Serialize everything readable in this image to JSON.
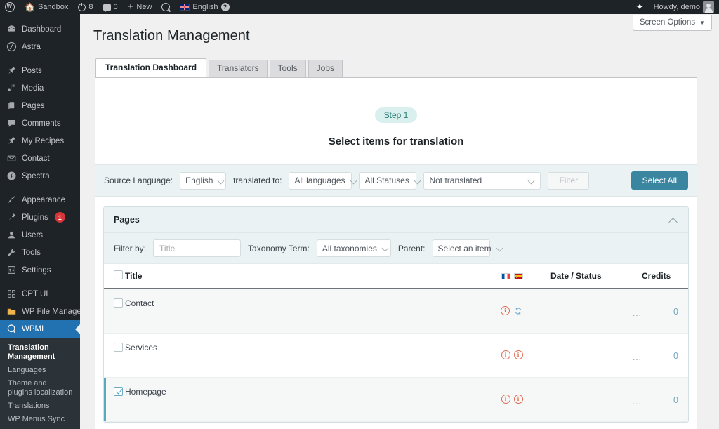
{
  "adminbar": {
    "logo_icon": "wordpress-logo-icon",
    "items": [
      {
        "icon": "home-icon",
        "label": "Sandbox"
      },
      {
        "icon": "updates-icon",
        "label": "8"
      },
      {
        "icon": "comment-bubble-icon",
        "label": "0"
      },
      {
        "icon": "plus-icon",
        "label": "New"
      },
      {
        "icon": "query-monitor-icon",
        "label": ""
      },
      {
        "icon": "uk-flag-icon",
        "label": "English",
        "badge": "?"
      }
    ],
    "right": {
      "sparkle_icon": "sparkle-icon",
      "greeting": "Howdy, demo",
      "avatar_icon": "avatar"
    }
  },
  "sidebar": {
    "items": [
      {
        "label": "Dashboard",
        "icon": "dashboard-icon"
      },
      {
        "label": "Astra",
        "icon": "astra-icon"
      },
      {
        "separator": true
      },
      {
        "label": "Posts",
        "icon": "pin-icon"
      },
      {
        "label": "Media",
        "icon": "media-icon"
      },
      {
        "label": "Pages",
        "icon": "pages-icon"
      },
      {
        "label": "Comments",
        "icon": "comment-icon"
      },
      {
        "label": "My Recipes",
        "icon": "pin-icon"
      },
      {
        "label": "Contact",
        "icon": "envelope-icon"
      },
      {
        "label": "Spectra",
        "icon": "spectra-icon"
      },
      {
        "separator": true
      },
      {
        "label": "Appearance",
        "icon": "brush-icon"
      },
      {
        "label": "Plugins",
        "icon": "plug-icon",
        "badge": "1"
      },
      {
        "label": "Users",
        "icon": "user-icon"
      },
      {
        "label": "Tools",
        "icon": "wrench-icon"
      },
      {
        "label": "Settings",
        "icon": "settings-icon"
      },
      {
        "separator": true
      },
      {
        "label": "CPT UI",
        "icon": "cptui-icon"
      },
      {
        "label": "WP File Manager",
        "icon": "folder-icon"
      },
      {
        "label": "WPML",
        "icon": "wpml-icon",
        "current": true
      }
    ],
    "submenu": [
      {
        "label": "Translation Management",
        "active": true
      },
      {
        "label": "Languages"
      },
      {
        "label": "Theme and plugins localization"
      },
      {
        "label": "Translations"
      },
      {
        "label": "WP Menus Sync"
      }
    ]
  },
  "screen_options": {
    "label": "Screen Options",
    "caret": "▼"
  },
  "page": {
    "title": "Translation Management"
  },
  "tabs": [
    {
      "label": "Translation Dashboard",
      "active": true
    },
    {
      "label": "Translators",
      "active": false
    },
    {
      "label": "Tools",
      "active": false
    },
    {
      "label": "Jobs",
      "active": false
    }
  ],
  "step": {
    "pill": "Step 1",
    "heading": "Select items for translation"
  },
  "filterbar": {
    "source_language_label": "Source Language:",
    "source_language_value": "English",
    "translated_to_label": "translated to:",
    "all_languages_value": "All languages",
    "all_statuses_value": "All Statuses",
    "not_translated_value": "Not translated",
    "filter_button": "Filter",
    "select_all_button": "Select All",
    "accent_color": "#3a86a0"
  },
  "pages_box": {
    "title": "Pages",
    "collapse_icon": "chevron-up-icon",
    "filter_by_label": "Filter by:",
    "filter_by_placeholder": "Title",
    "taxonomy_label": "Taxonomy Term:",
    "taxonomy_value": "All taxonomies",
    "parent_label": "Parent:",
    "parent_value": "Select an item"
  },
  "table": {
    "columns": {
      "title": "Title",
      "languages": [
        "fr",
        "es"
      ],
      "date_status": "Date / Status",
      "credits": "Credits"
    },
    "header_checkbox_checked": false,
    "rows": [
      {
        "title": "Contact",
        "checked": false,
        "lang_icons": [
          "not-translated-icon",
          "needs-update-icon"
        ],
        "date_status": "...",
        "credits": "0"
      },
      {
        "title": "Services",
        "checked": false,
        "lang_icons": [
          "not-translated-icon",
          "not-translated-icon"
        ],
        "date_status": "...",
        "credits": "0"
      },
      {
        "title": "Homepage",
        "checked": true,
        "lang_icons": [
          "not-translated-icon",
          "not-translated-icon"
        ],
        "date_status": "...",
        "credits": "0"
      }
    ]
  }
}
